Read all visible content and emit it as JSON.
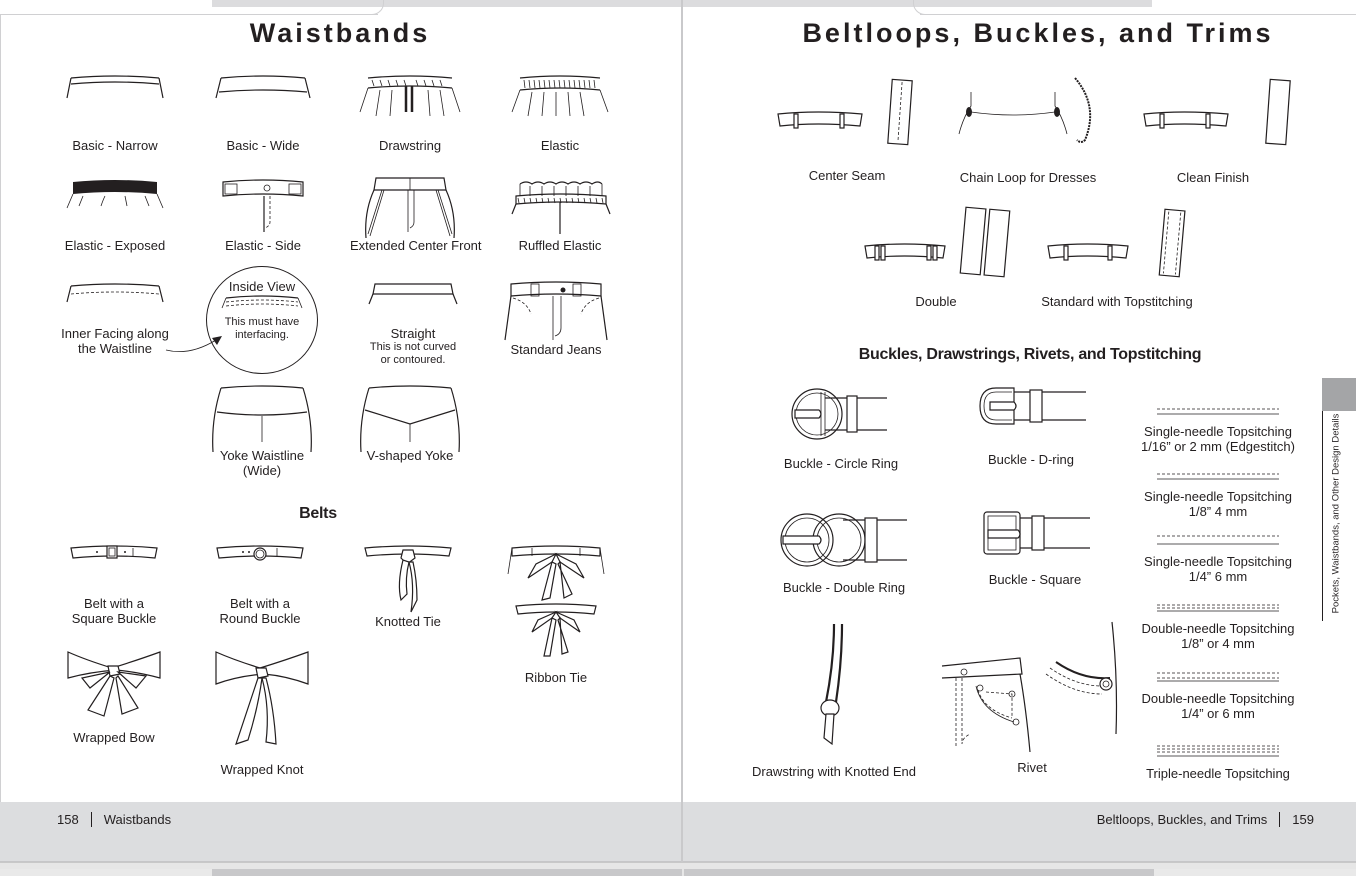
{
  "left_page": {
    "title": "Waistbands",
    "waistbands": [
      {
        "label": "Basic - Narrow"
      },
      {
        "label": "Basic - Wide"
      },
      {
        "label": "Drawstring"
      },
      {
        "label": "Elastic"
      },
      {
        "label": "Elastic - Exposed"
      },
      {
        "label": "Elastic - Side"
      },
      {
        "label": "Extended Center Front"
      },
      {
        "label": "Ruffled Elastic"
      },
      {
        "label_line1": "Inner Facing along",
        "label_line2": "the Waistline"
      },
      {
        "callout_title": "Inside View",
        "callout_line1": "This must have",
        "callout_line2": "interfacing."
      },
      {
        "label": "Straight",
        "note_line1": "This is not curved",
        "note_line2": "or contoured."
      },
      {
        "label": "Standard Jeans"
      },
      {
        "label_line1": "Yoke Waistline",
        "label_line2": "(Wide)"
      },
      {
        "label": "V-shaped Yoke"
      }
    ],
    "belts_title": "Belts",
    "belts": [
      {
        "label_line1": "Belt with a",
        "label_line2": "Square Buckle"
      },
      {
        "label_line1": "Belt with a",
        "label_line2": "Round Buckle"
      },
      {
        "label": "Knotted Tie"
      },
      {
        "label": "Ribbon Tie"
      },
      {
        "label": "Wrapped Bow"
      },
      {
        "label": "Wrapped Knot"
      }
    ],
    "footer": {
      "page_number": "158",
      "section": "Waistbands"
    }
  },
  "right_page": {
    "title": "Beltloops, Buckles, and Trims",
    "beltloops": [
      {
        "label": "Center Seam"
      },
      {
        "label": "Chain Loop for Dresses"
      },
      {
        "label": "Clean Finish"
      },
      {
        "label": "Double"
      },
      {
        "label": "Standard with Topstitching"
      }
    ],
    "hardware_title": "Buckles, Drawstrings, Rivets, and Topstitching",
    "buckles": [
      {
        "label": "Buckle - Circle Ring"
      },
      {
        "label": "Buckle - D-ring"
      },
      {
        "label": "Buckle - Double Ring"
      },
      {
        "label": "Buckle - Square"
      },
      {
        "label": "Drawstring with Knotted End"
      },
      {
        "label": "Rivet"
      }
    ],
    "topstitching": [
      {
        "line1": "Single-needle Topsitching",
        "line2": "1/16” or 2 mm (Edgestitch)"
      },
      {
        "line1": "Single-needle Topsitching",
        "line2": "1/8” 4 mm"
      },
      {
        "line1": "Single-needle Topsitching",
        "line2": "1/4” 6 mm"
      },
      {
        "line1": "Double-needle Topsitching",
        "line2": "1/8” or 4 mm"
      },
      {
        "line1": "Double-needle Topsitching",
        "line2": "1/4” or 6 mm"
      },
      {
        "line1": "Triple-needle Topsitching",
        "line2": ""
      }
    ],
    "side_tab_label": "Pockets, Waistbands, and Other Design Details",
    "footer": {
      "section": "Beltloops, Buckles, and Trims",
      "page_number": "159"
    }
  }
}
